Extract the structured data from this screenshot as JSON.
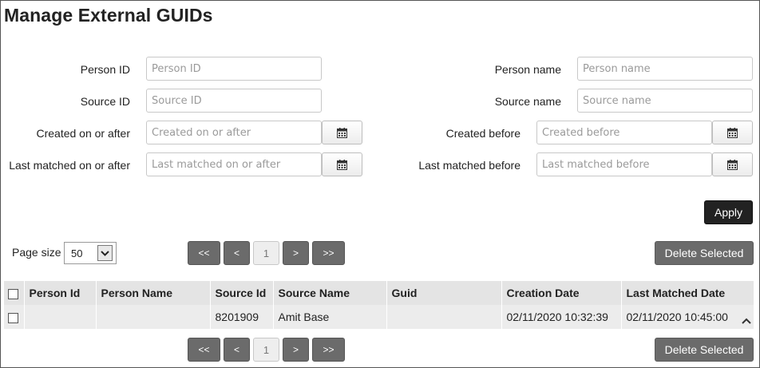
{
  "page": {
    "title": "Manage External GUIDs"
  },
  "filters": {
    "person_id": {
      "label": "Person ID",
      "placeholder": "Person ID",
      "value": ""
    },
    "person_name": {
      "label": "Person name",
      "placeholder": "Person name",
      "value": ""
    },
    "source_id": {
      "label": "Source ID",
      "placeholder": "Source ID",
      "value": ""
    },
    "source_name": {
      "label": "Source name",
      "placeholder": "Source name",
      "value": ""
    },
    "created_after": {
      "label": "Created on or after",
      "placeholder": "Created on or after",
      "value": ""
    },
    "created_before": {
      "label": "Created before",
      "placeholder": "Created before",
      "value": ""
    },
    "matched_after": {
      "label": "Last matched on or after",
      "placeholder": "Last matched on or after",
      "value": ""
    },
    "matched_before": {
      "label": "Last matched before",
      "placeholder": "Last matched before",
      "value": ""
    },
    "apply_label": "Apply"
  },
  "pagination": {
    "page_size_label": "Page size",
    "page_size_value": "50",
    "first": "<<",
    "prev": "<",
    "current": "1",
    "next": ">",
    "last": ">>"
  },
  "actions": {
    "delete_selected": "Delete Selected"
  },
  "table": {
    "columns": [
      "Person Id",
      "Person Name",
      "Source Id",
      "Source Name",
      "Guid",
      "Creation Date",
      "Last Matched Date"
    ],
    "rows": [
      {
        "person_id": "",
        "person_name": "",
        "source_id": "8201909",
        "source_name": "Amit Base",
        "guid": "",
        "creation_date": "02/11/2020 10:32:39",
        "last_matched_date": "02/11/2020 10:45:00"
      }
    ]
  },
  "icons": {
    "calendar": "calendar-icon",
    "dropdown": "chevron-down-icon",
    "scroll": "chevron-up-icon"
  }
}
